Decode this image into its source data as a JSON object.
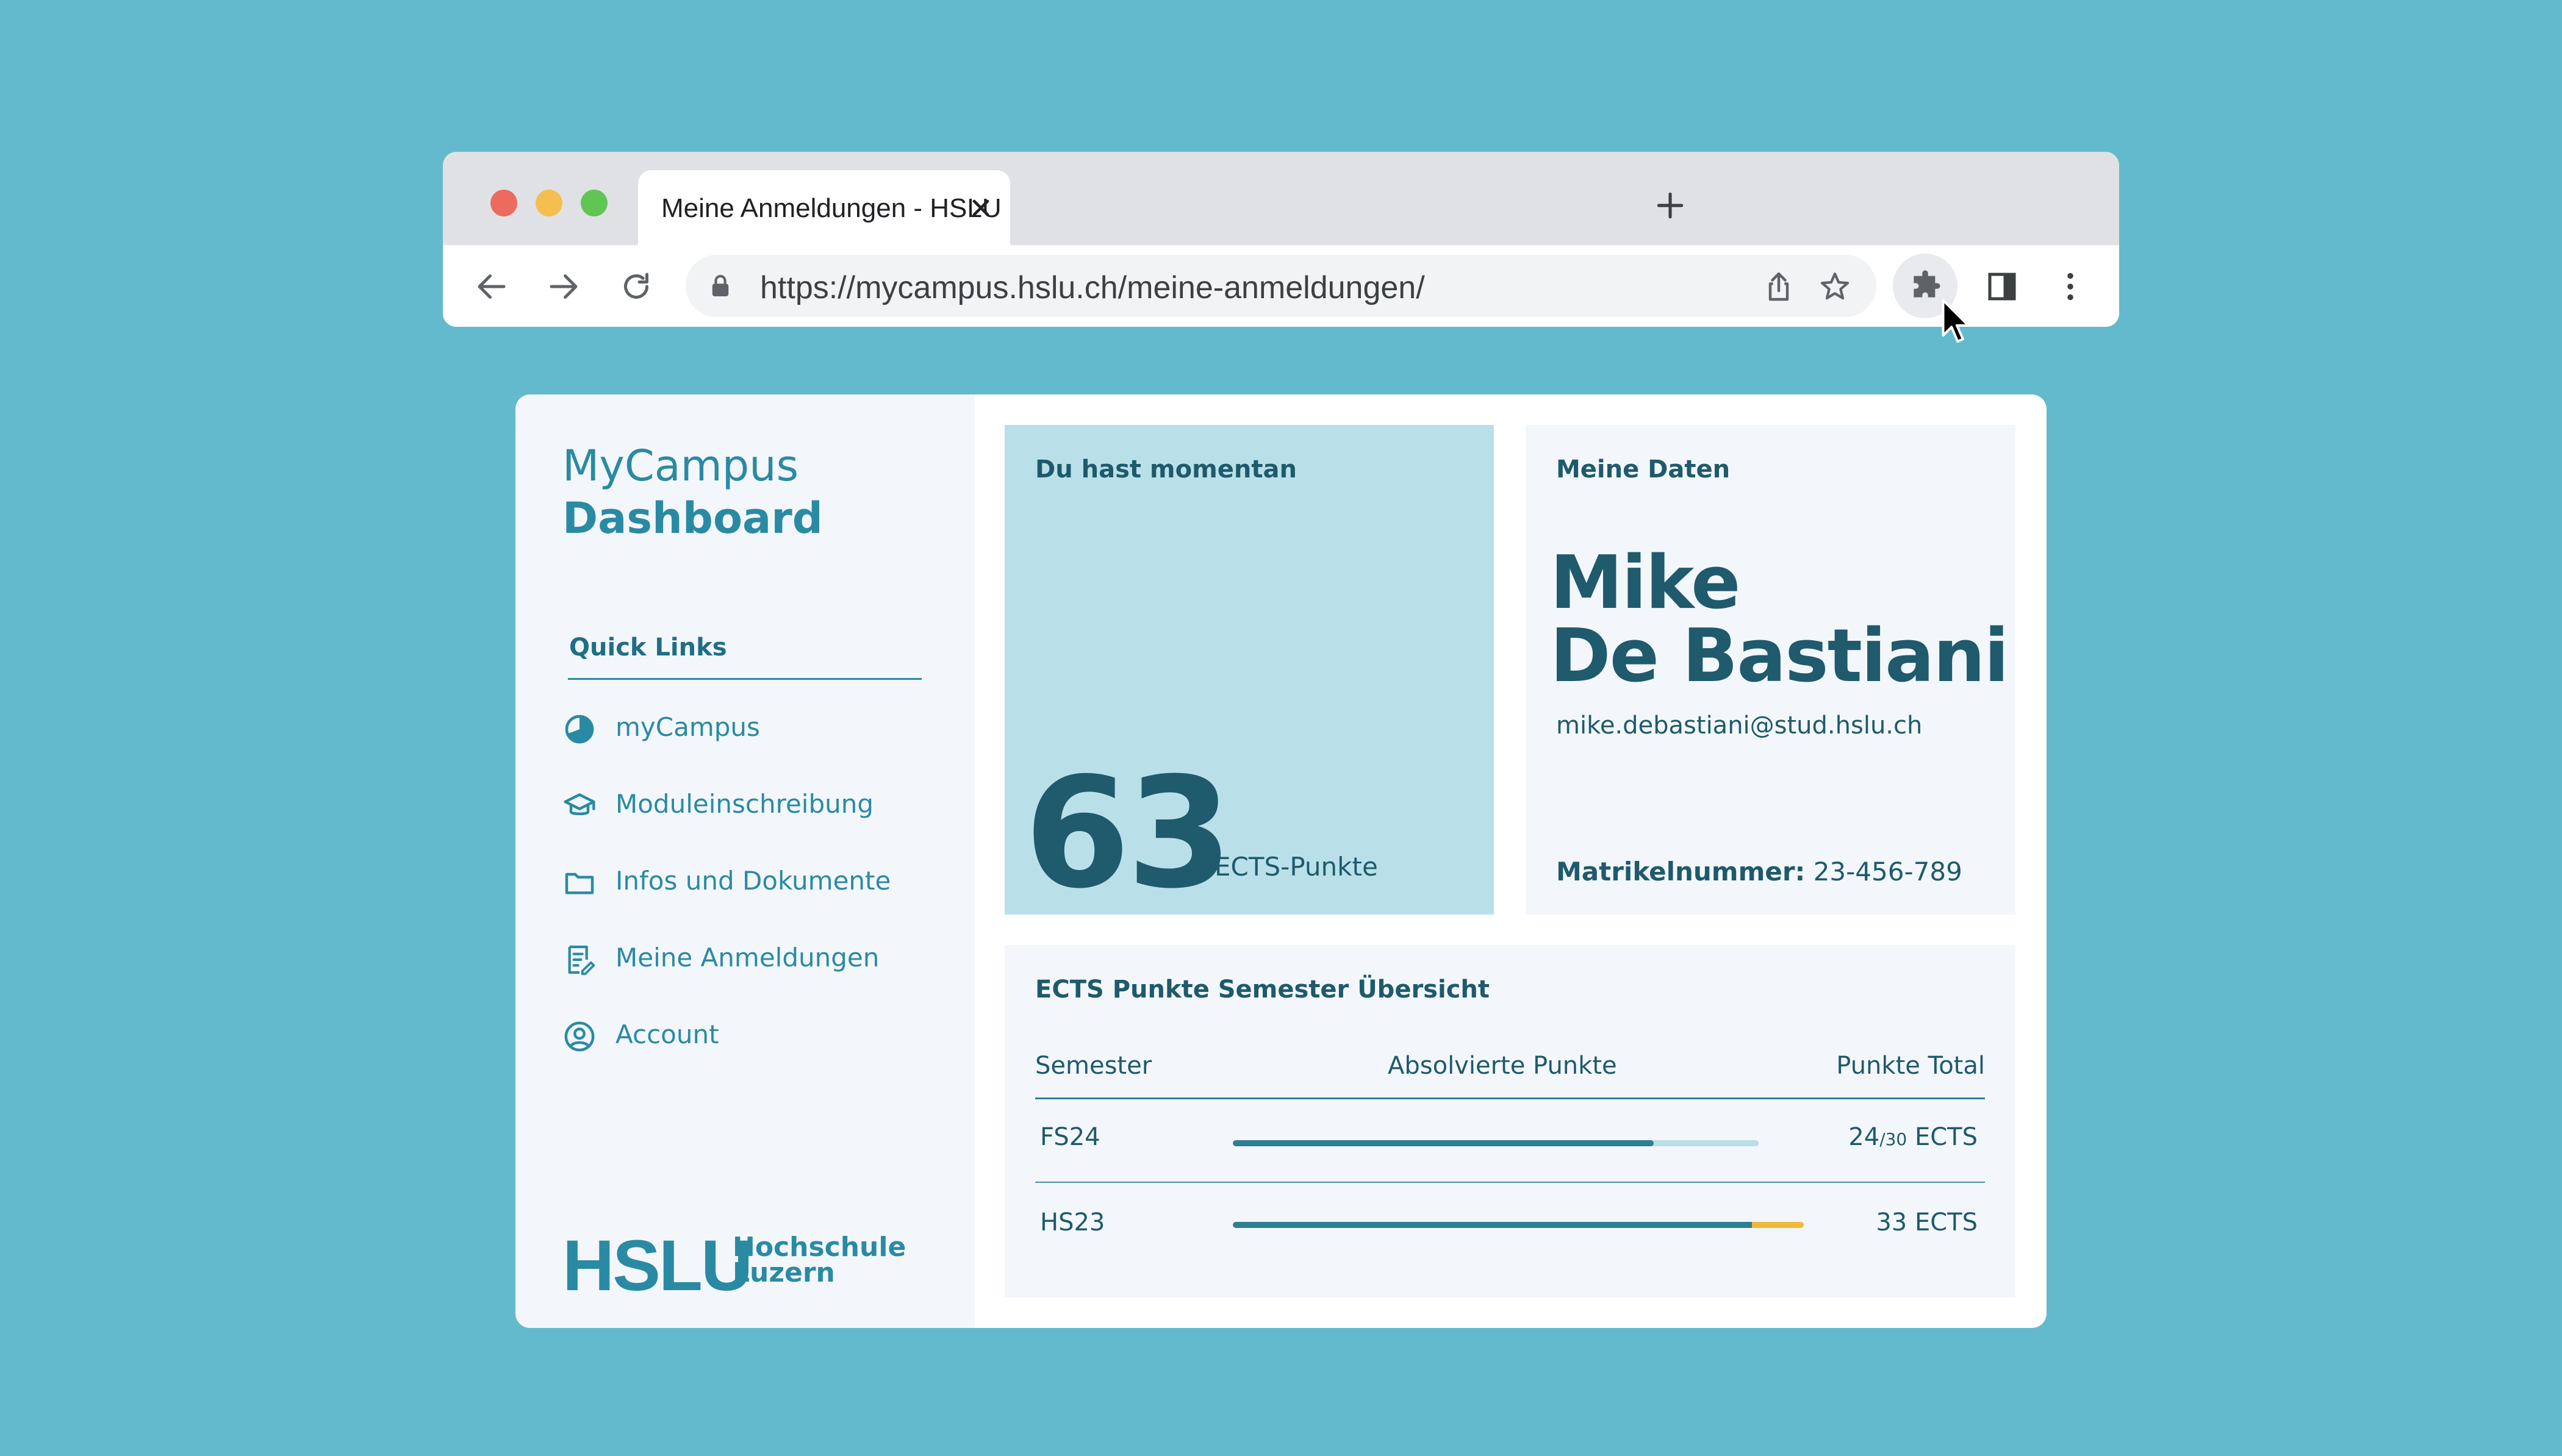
{
  "browser": {
    "tab_title": "Meine Anmeldungen - HSLU",
    "url": "https://mycampus.hslu.ch/meine-anmeldungen/",
    "icons": [
      "close-icon",
      "plus-icon",
      "chevron-down-icon",
      "back-arrow-icon",
      "forward-arrow-icon",
      "reload-icon",
      "lock-icon",
      "share-icon",
      "star-icon",
      "puzzle-icon",
      "sidepanel-icon",
      "more-vert-icon",
      "cursor-icon"
    ]
  },
  "sidebar": {
    "brand_line1": "MyCampus",
    "brand_line2": "Dashboard",
    "quick_links_title": "Quick Links",
    "items": [
      {
        "label": "myCampus",
        "icon": "pie-chart-icon"
      },
      {
        "label": "Moduleinschreibung",
        "icon": "graduation-cap-icon"
      },
      {
        "label": "Infos und Dokumente",
        "icon": "folder-icon"
      },
      {
        "label": "Meine Anmeldungen",
        "icon": "registration-icon"
      },
      {
        "label": "Account",
        "icon": "user-circle-icon"
      }
    ],
    "logo_mark": "HSLU",
    "logo_line1": "Hochschule",
    "logo_line2": "Luzern"
  },
  "ects_card": {
    "title": "Du hast momentan",
    "value": "63",
    "unit": "ECTS-Punkte"
  },
  "data_card": {
    "title": "Meine Daten",
    "first_name": "Mike",
    "last_name": "De Bastiani",
    "email": "mike.debastiani@stud.hslu.ch",
    "matrikel_label": "Matrikelnummer:",
    "matrikel_value": "23-456-789"
  },
  "semester_table": {
    "title": "ECTS Punkte Semester Übersicht",
    "headers": [
      "Semester",
      "Absolvierte Punkte",
      "Punkte Total"
    ],
    "rows": [
      {
        "semester": "FS24",
        "points": "24",
        "points_total_part": "/30",
        "unit": " ECTS",
        "completed": 24,
        "total": 30
      },
      {
        "semester": "HS23",
        "points": "33",
        "unit": " ECTS",
        "completed": 33,
        "total": 30
      }
    ]
  },
  "colors": {
    "background": "#64bacd",
    "accent": "#2a8aa3",
    "dark": "#1f5a6d",
    "ects_card": "#b9e0e8",
    "bar_extra": "#f0b93b"
  }
}
